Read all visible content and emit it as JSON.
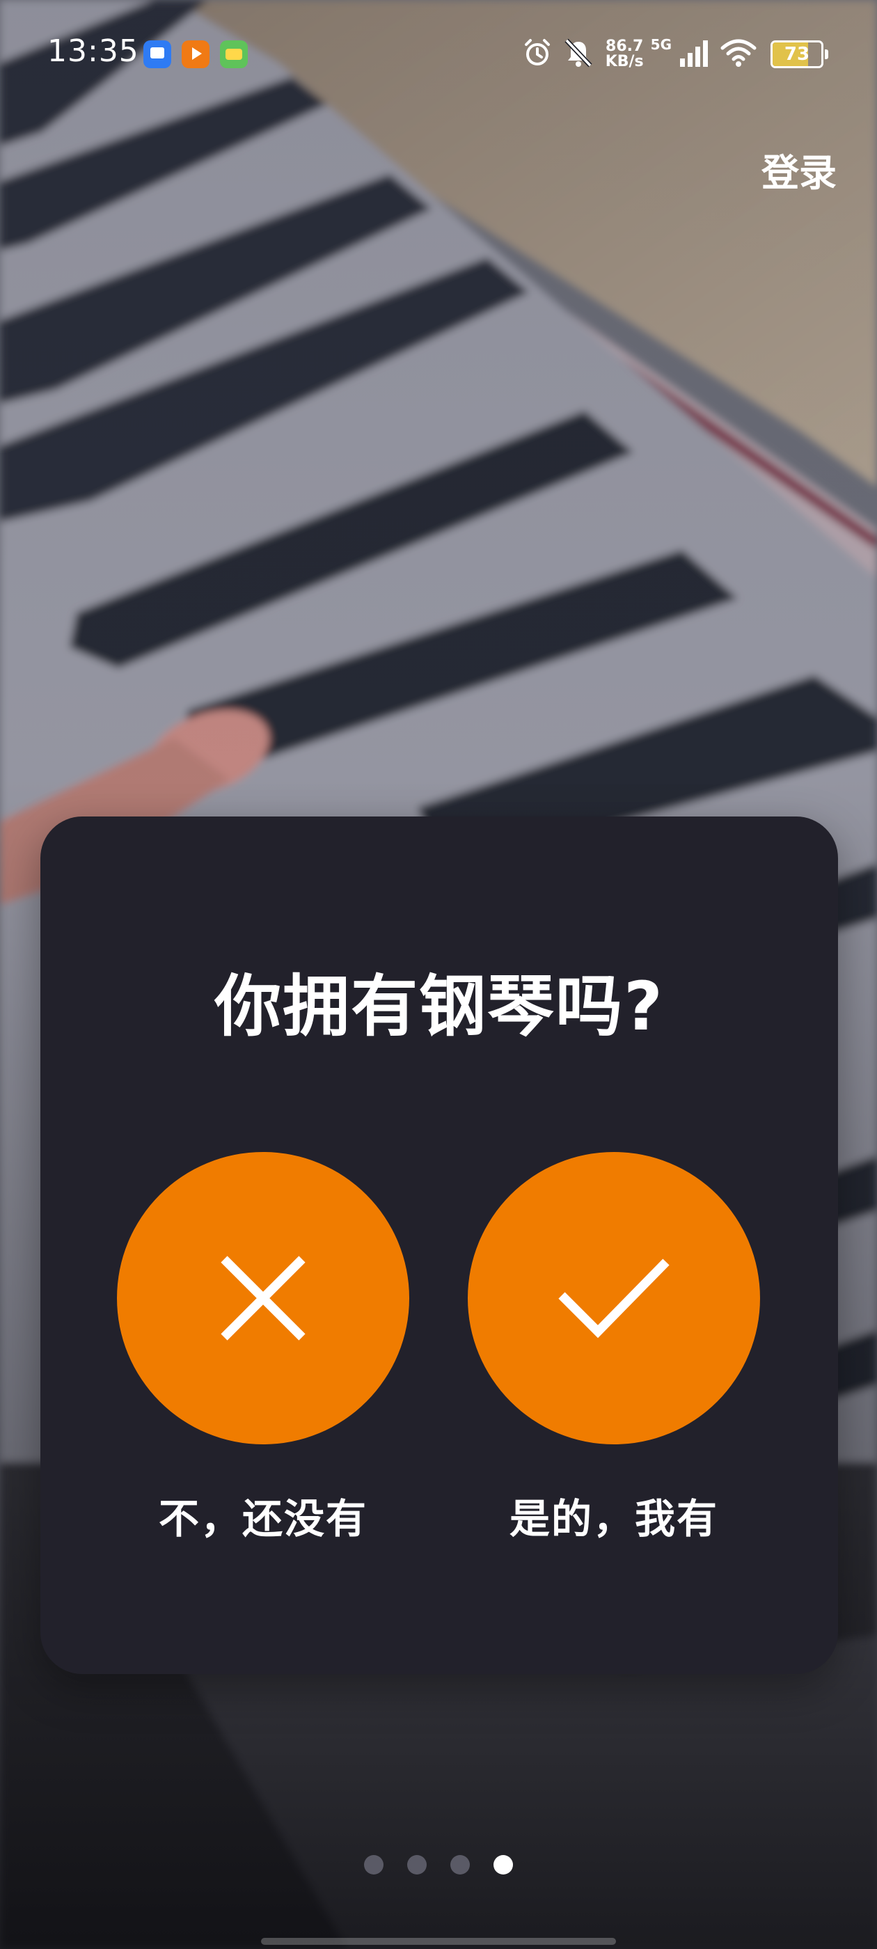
{
  "status_bar": {
    "time": "13:35",
    "apps": [
      "message-app-icon",
      "video-app-icon",
      "game-app-icon"
    ],
    "speed_value": "86.7",
    "speed_unit": "KB/s",
    "network": "5G",
    "battery": "73",
    "battery_level": 0.73
  },
  "header": {
    "login_label": "登录"
  },
  "dialog": {
    "title": "你拥有钢琴吗?",
    "no_label": "不，还没有",
    "yes_label": "是的，我有",
    "accent_color": "#F07C00"
  },
  "pagination": {
    "total": 4,
    "active_index": 3
  }
}
